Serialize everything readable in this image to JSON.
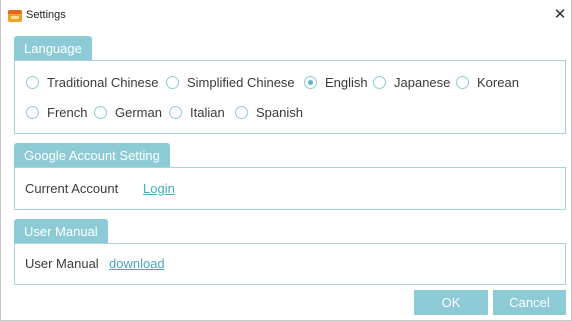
{
  "window": {
    "title": "Settings",
    "app_icon": "settings-app-icon",
    "close_glyph": "✕"
  },
  "language": {
    "tab_label": "Language",
    "options": [
      {
        "label": "Traditional Chinese",
        "selected": false
      },
      {
        "label": "Simplified Chinese",
        "selected": false
      },
      {
        "label": "English",
        "selected": true
      },
      {
        "label": "Japanese",
        "selected": false
      },
      {
        "label": "Korean",
        "selected": false
      },
      {
        "label": "French",
        "selected": false
      },
      {
        "label": "German",
        "selected": false
      },
      {
        "label": "Italian",
        "selected": false
      },
      {
        "label": "Spanish",
        "selected": false
      }
    ]
  },
  "google_account": {
    "tab_label": "Google Account Setting",
    "current_account_label": "Current Account",
    "login_link": "Login"
  },
  "user_manual": {
    "tab_label": "User Manual",
    "label": "User Manual",
    "download_link": "download"
  },
  "buttons": {
    "ok": "OK",
    "cancel": "Cancel"
  },
  "colors": {
    "accent": "#8ccbd6",
    "border": "#a7d3dc",
    "link": "#4aa7bd"
  }
}
